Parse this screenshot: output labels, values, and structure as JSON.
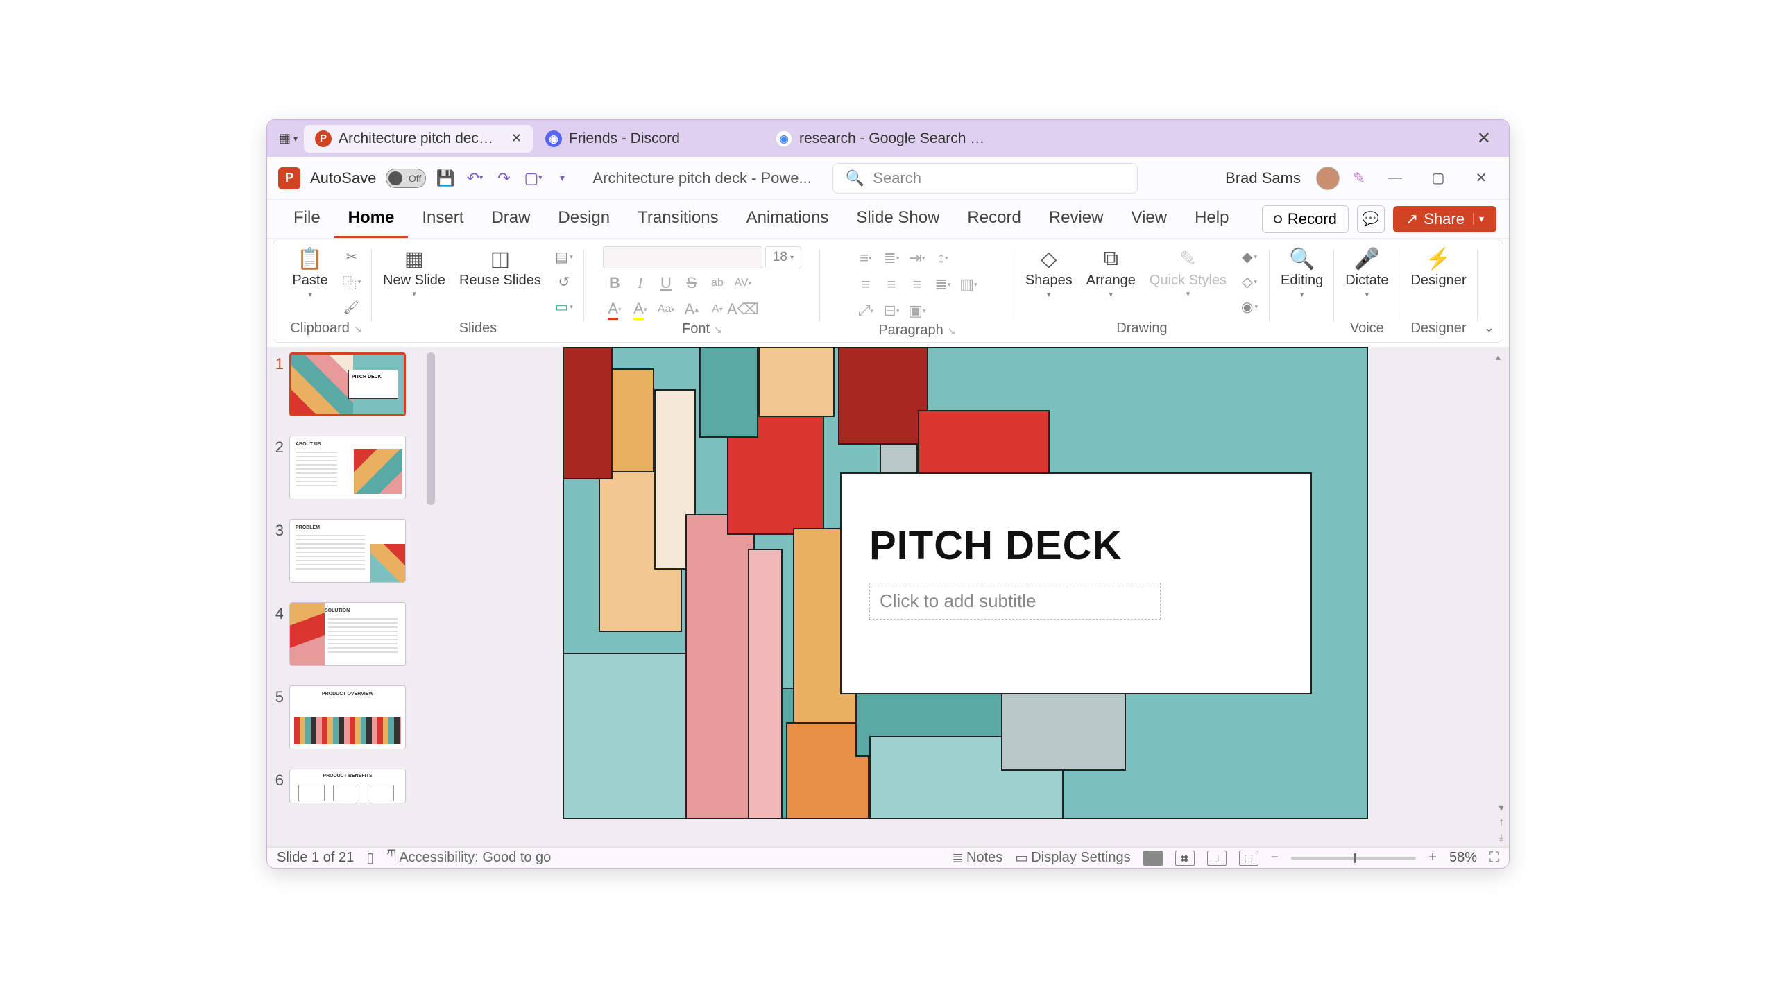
{
  "browser": {
    "tabs": [
      {
        "label": "Architecture pitch deck - Po...",
        "active": true,
        "icon": "pp"
      },
      {
        "label": "Friends - Discord",
        "active": false,
        "icon": "dc"
      },
      {
        "label": "research - Google Search - Goo...",
        "active": false,
        "icon": "gg"
      }
    ]
  },
  "titlebar": {
    "autosave": "AutoSave",
    "autosave_state": "Off",
    "doc_title": "Architecture pitch deck  -  Powe...",
    "search_placeholder": "Search",
    "user": "Brad Sams"
  },
  "ribbon_tabs": [
    "File",
    "Home",
    "Insert",
    "Draw",
    "Design",
    "Transitions",
    "Animations",
    "Slide Show",
    "Record",
    "Review",
    "View",
    "Help"
  ],
  "ribbon_active": "Home",
  "ribbon_right": {
    "record": "Record",
    "share": "Share"
  },
  "groups": {
    "clipboard": {
      "label": "Clipboard",
      "paste": "Paste"
    },
    "slides": {
      "label": "Slides",
      "new_slide": "New Slide",
      "reuse": "Reuse Slides"
    },
    "font": {
      "label": "Font",
      "size": "18"
    },
    "paragraph": {
      "label": "Paragraph"
    },
    "drawing": {
      "label": "Drawing",
      "shapes": "Shapes",
      "arrange": "Arrange",
      "quick": "Quick Styles"
    },
    "editing": {
      "label": "Editing"
    },
    "voice": {
      "label": "Voice",
      "dictate": "Dictate"
    },
    "designer": {
      "label": "Designer",
      "designer": "Designer"
    }
  },
  "slide": {
    "title": "PITCH DECK",
    "subtitle_placeholder": "Click to add subtitle"
  },
  "thumbs": [
    1,
    2,
    3,
    4,
    5,
    6
  ],
  "thumb_selected": 1,
  "status": {
    "slide": "Slide 1 of 21",
    "access": "Accessibility: Good to go",
    "notes": "Notes",
    "display": "Display Settings",
    "zoom": "58%"
  }
}
